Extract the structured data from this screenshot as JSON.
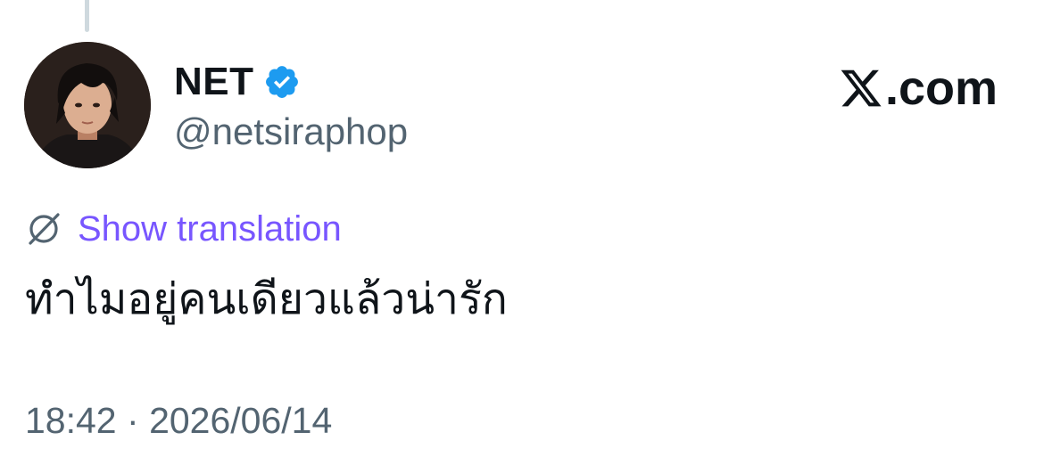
{
  "post": {
    "author": {
      "display_name": "NET",
      "handle": "@netsiraphop",
      "verified": true,
      "avatar_icon": "profile-photo"
    },
    "translation_link": "Show translation",
    "translate_icon": "globe-slash-icon",
    "text": "ทำไมอยู่คนเดียวแล้วน่ารัก",
    "time": "18:42",
    "separator": "·",
    "date": "2026/06/14"
  },
  "brand": {
    "suffix": ".com"
  },
  "colors": {
    "text_primary": "#0f1419",
    "text_secondary": "#536471",
    "translation_link": "#7856ff",
    "verified_badge": "#1d9bf0",
    "thread_line": "#cfd9de"
  }
}
